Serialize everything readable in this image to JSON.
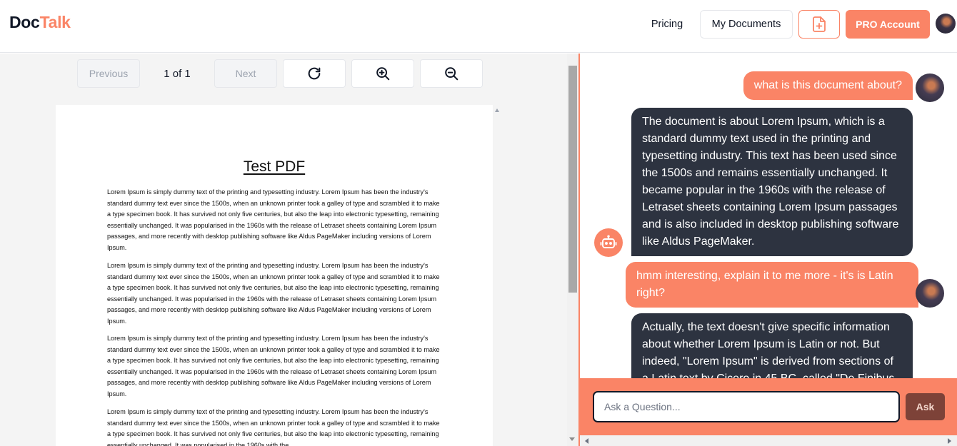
{
  "header": {
    "logo_part1": "Doc",
    "logo_part2": "Talk",
    "pricing_label": "Pricing",
    "my_documents_label": "My Documents",
    "pro_label": "PRO Account"
  },
  "toolbar": {
    "previous_label": "Previous",
    "page_indicator": "1 of 1",
    "next_label": "Next"
  },
  "pdf": {
    "title": "Test PDF",
    "paragraphs": [
      "Lorem Ipsum is simply dummy text of the printing and typesetting industry. Lorem Ipsum has been the industry's standard dummy text ever since the 1500s, when an unknown printer took a galley of type and scrambled it to make a type specimen book. It has survived not only five centuries, but also the leap into electronic typesetting, remaining essentially unchanged. It was popularised in the 1960s with the release of Letraset sheets containing Lorem Ipsum passages, and more recently with desktop publishing software like Aldus PageMaker including versions of Lorem Ipsum.",
      "Lorem Ipsum is simply dummy text of the printing and typesetting industry. Lorem Ipsum has been the industry's standard dummy text ever since the 1500s, when an unknown printer took a galley of type and scrambled it to make a type specimen book. It has survived not only five centuries, but also the leap into electronic typesetting, remaining essentially unchanged. It was popularised in the 1960s with the release of Letraset sheets containing Lorem Ipsum passages, and more recently with desktop publishing software like Aldus PageMaker including versions of Lorem Ipsum.",
      "Lorem Ipsum is simply dummy text of the printing and typesetting industry. Lorem Ipsum has been the industry's standard dummy text ever since the 1500s, when an unknown printer took a galley of type and scrambled it to make a type specimen book. It has survived not only five centuries, but also the leap into electronic typesetting, remaining essentially unchanged. It was popularised in the 1960s with the release of Letraset sheets containing Lorem Ipsum passages, and more recently with desktop publishing software like Aldus PageMaker including versions of Lorem Ipsum.",
      "Lorem Ipsum is simply dummy text of the printing and typesetting industry. Lorem Ipsum has been the industry's standard dummy text ever since the 1500s, when an unknown printer took a galley of type and scrambled it to make a type specimen book. It has survived not only five centuries, but also the leap into electronic typesetting, remaining essentially unchanged. It was popularised in the 1960s with the"
    ]
  },
  "chat": {
    "messages": [
      {
        "role": "user",
        "text": "what is this document about?"
      },
      {
        "role": "assistant",
        "text": "The document is about Lorem Ipsum, which is a standard dummy text used in the printing and typesetting industry. This text has been used since the 1500s and remains essentially unchanged. It became popular in the 1960s with the release of Letraset sheets containing Lorem Ipsum passages and is also included in desktop publishing software like Aldus PageMaker."
      },
      {
        "role": "user",
        "text": "hmm interesting, explain it to me more - it's is Latin right?"
      },
      {
        "role": "assistant",
        "text": "Actually, the text doesn't give specific information about whether Lorem Ipsum is Latin or not. But indeed, \"Lorem Ipsum\" is derived from sections of a Latin text by Cicero in 45 BC, called \"De Finibus"
      }
    ],
    "input_placeholder": "Ask a Question...",
    "ask_label": "Ask"
  },
  "icons": {
    "upload": "file-plus-icon",
    "refresh": "refresh-icon",
    "zoom_in": "zoom-in-icon",
    "zoom_out": "zoom-out-icon",
    "bot": "robot-icon"
  },
  "colors": {
    "accent": "#fa8466",
    "bot_bubble": "#2d3340",
    "ask_button": "#7d4238"
  }
}
